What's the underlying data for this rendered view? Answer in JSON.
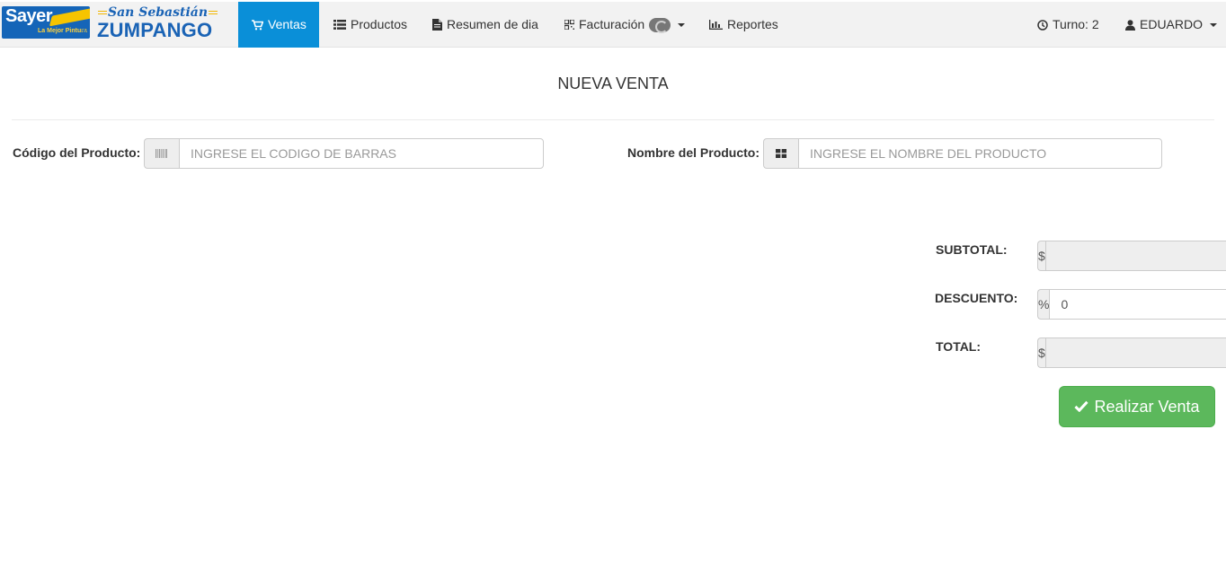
{
  "brand": {
    "sayer": "Sayer",
    "tagline": "La Mejor Pintura",
    "registered": "®",
    "store_line1": "San Sebastián",
    "store_line2": "ZUMPANGO"
  },
  "nav": {
    "ventas": "Ventas",
    "productos": "Productos",
    "resumen": "Resumen de dia",
    "facturacion": "Facturación",
    "reportes": "Reportes",
    "turno": "Turno: 2",
    "user": "EDUARDO"
  },
  "page": {
    "title": "NUEVA VENTA"
  },
  "search": {
    "codigo_label": "Código del Producto:",
    "codigo_placeholder": "INGRESE EL CODIGO DE BARRAS",
    "nombre_label": "Nombre del Producto:",
    "nombre_placeholder": "INGRESE EL NOMBRE DEL PRODUCTO"
  },
  "totals": {
    "subtotal_label": "SUBTOTAL:",
    "subtotal_addon": "$",
    "subtotal_value": "",
    "descuento_label": "DESCUENTO:",
    "descuento_addon": "%",
    "descuento_value": "0",
    "total_label": "TOTAL:",
    "total_addon": "$",
    "total_value": ""
  },
  "actions": {
    "realizar_venta": "Realizar Venta"
  },
  "colors": {
    "nav_active": "#0a8fd8",
    "success": "#5cb85c",
    "brand_blue": "#1565b8"
  },
  "icons": {
    "ventas": "shopping-cart-icon",
    "productos": "list-icon",
    "resumen": "file-icon",
    "facturacion": "qrcode-icon",
    "reportes": "bar-chart-icon",
    "turno": "clock-icon",
    "user": "user-icon",
    "codigo": "barcode-icon",
    "nombre": "grid-icon",
    "venta": "check-icon"
  }
}
